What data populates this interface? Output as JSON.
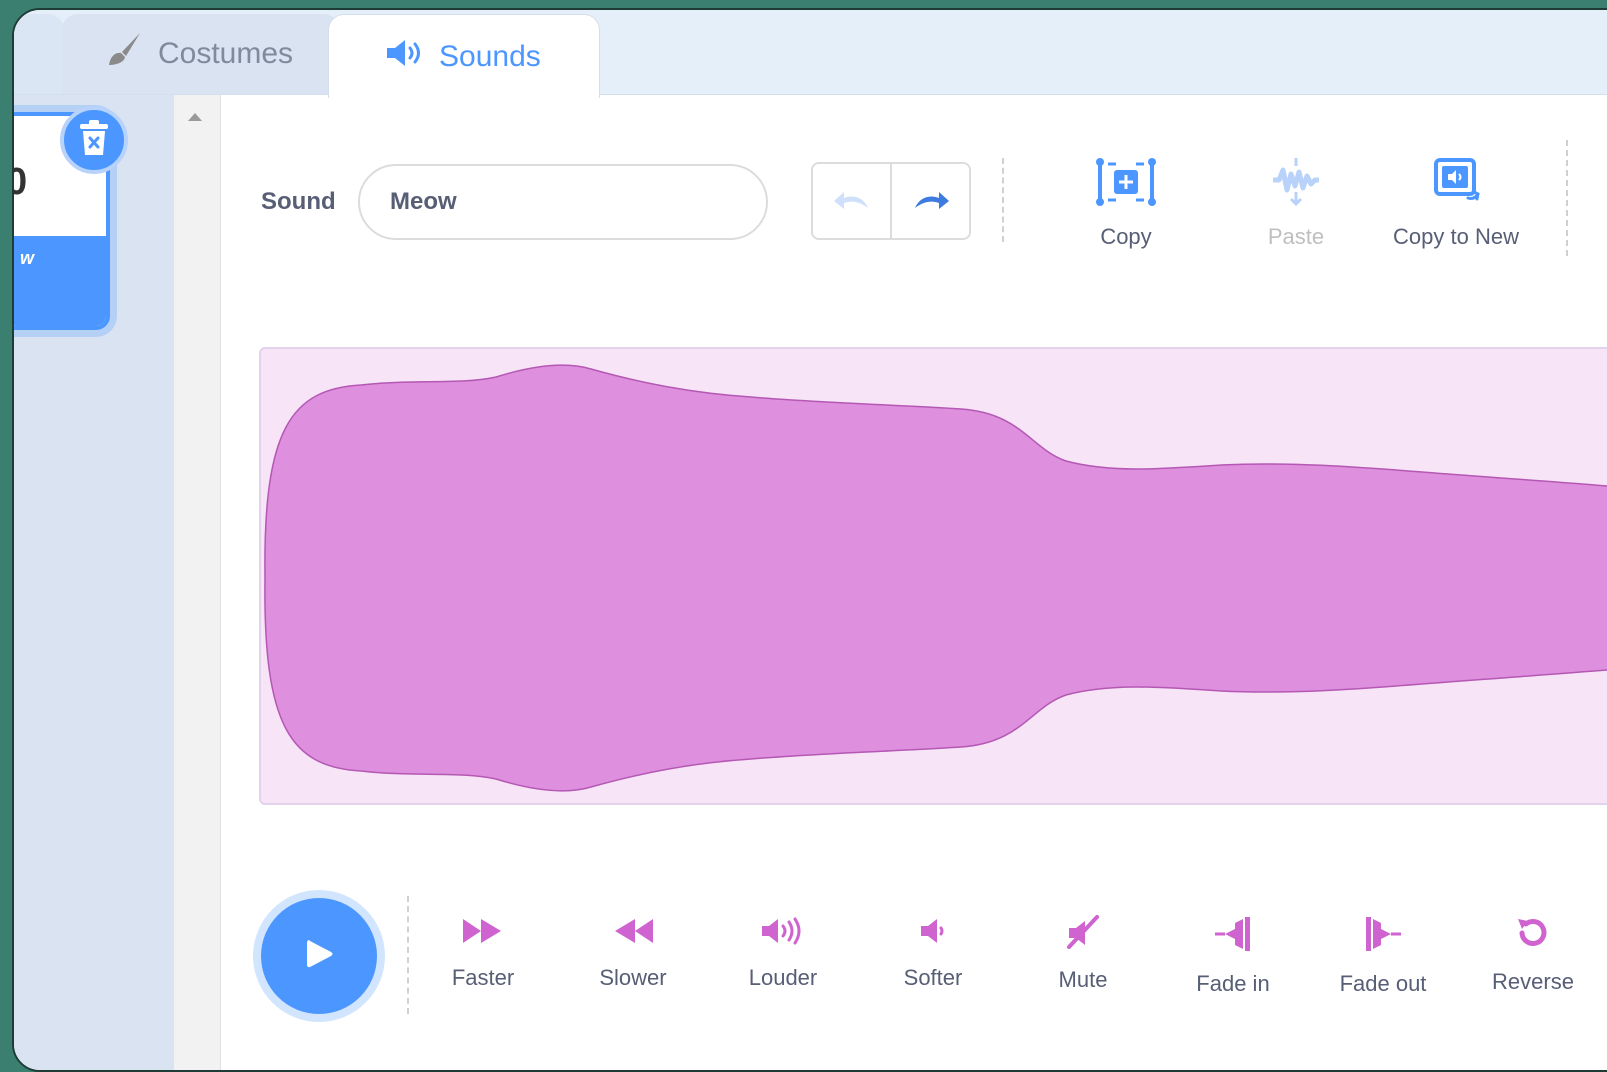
{
  "tabs": {
    "costumes": {
      "label": "Costumes",
      "icon": "brush-icon"
    },
    "sounds": {
      "label": "Sounds",
      "icon": "speaker-icon"
    }
  },
  "sound_list": {
    "selected_item": {
      "number": "0",
      "name_fragment": "w"
    },
    "delete_icon": "trash-icon"
  },
  "editor": {
    "sound_label": "Sound",
    "sound_name_value": "Meow",
    "undo_icon": "undo-icon",
    "redo_icon": "redo-icon",
    "tools": [
      {
        "label": "Copy",
        "icon": "copy-icon",
        "enabled": true
      },
      {
        "label": "Paste",
        "icon": "paste-icon",
        "enabled": false
      },
      {
        "label": "Copy to New",
        "icon": "copy-to-new-icon",
        "enabled": true
      }
    ]
  },
  "effects": [
    {
      "label": "Faster",
      "icon": "faster-icon"
    },
    {
      "label": "Slower",
      "icon": "slower-icon"
    },
    {
      "label": "Louder",
      "icon": "louder-icon"
    },
    {
      "label": "Softer",
      "icon": "softer-icon"
    },
    {
      "label": "Mute",
      "icon": "mute-icon"
    },
    {
      "label": "Fade in",
      "icon": "fade-in-icon"
    },
    {
      "label": "Fade out",
      "icon": "fade-out-icon"
    },
    {
      "label": "Reverse",
      "icon": "reverse-icon"
    }
  ],
  "colors": {
    "accent": "#4c97ff",
    "sound_effect": "#cf63cf",
    "waveform_fill": "#de8fde",
    "waveform_bg": "#f7e4f7"
  }
}
